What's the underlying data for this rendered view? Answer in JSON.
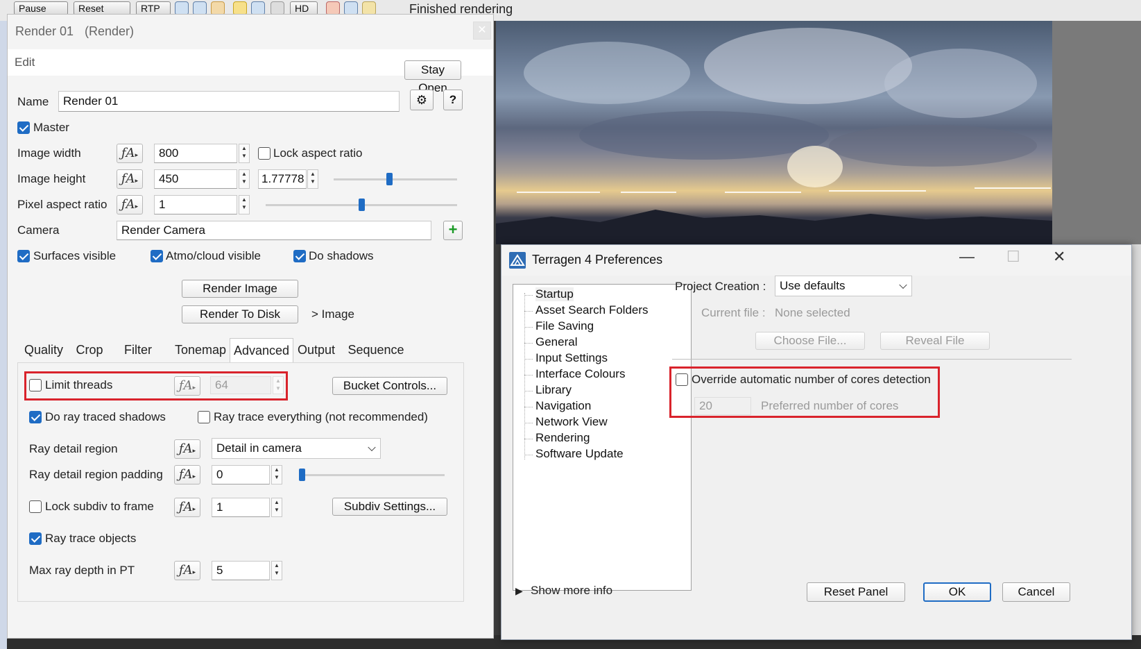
{
  "topbar": {
    "buttons": [
      "Pause",
      "Reset",
      "RTP",
      "HD"
    ],
    "status": "Finished rendering"
  },
  "render_panel": {
    "title": "Render 01",
    "subtitle": "(Render)",
    "menu": "Edit",
    "stay_open": "Stay Open",
    "name_label": "Name",
    "name_value": "Render 01",
    "help": "?",
    "master_label": "Master",
    "image_width_label": "Image width",
    "image_width_value": "800",
    "lock_aspect_label": "Lock aspect ratio",
    "image_height_label": "Image height",
    "image_height_value": "450",
    "aspect_value": "1.77778",
    "pixel_aspect_label": "Pixel aspect ratio",
    "pixel_aspect_value": "1",
    "camera_label": "Camera",
    "camera_value": "Render Camera",
    "surfaces_label": "Surfaces visible",
    "atmo_label": "Atmo/cloud visible",
    "shadows_label": "Do shadows",
    "render_image": "Render Image",
    "render_to_disk": "Render To Disk",
    "image_link": ">  Image",
    "tabs": [
      "Quality",
      "Crop",
      "Filter",
      "Tonemap",
      "Advanced",
      "Output",
      "Sequence"
    ],
    "active_tab": "Advanced",
    "limit_threads_label": "Limit threads",
    "limit_threads_value": "64",
    "bucket_controls": "Bucket Controls...",
    "ray_traced_shadows_label": "Do ray traced shadows",
    "ray_trace_everything_label": "Ray trace everything (not recommended)",
    "ray_detail_region_label": "Ray detail region",
    "ray_detail_region_value": "Detail in camera",
    "ray_detail_padding_label": "Ray detail region padding",
    "ray_detail_padding_value": "0",
    "lock_subdiv_label": "Lock subdiv to frame",
    "lock_subdiv_value": "1",
    "subdiv_settings": "Subdiv Settings...",
    "ray_trace_objects_label": "Ray trace objects",
    "max_ray_depth_label": "Max ray depth in PT",
    "max_ray_depth_value": "5",
    "checks": {
      "master": true,
      "lock_aspect": false,
      "surfaces": true,
      "atmo": true,
      "shadows": true,
      "limit_threads": false,
      "ray_traced_shadows": true,
      "ray_trace_everything": false,
      "lock_subdiv": false,
      "ray_trace_objects": true
    },
    "sliders": {
      "aspect_ratio_level": 0.45,
      "pixel_aspect_level": 0.5,
      "ray_padding_level": 0.0
    }
  },
  "prefs": {
    "title": "Terragen 4 Preferences",
    "tree": [
      "Startup",
      "Asset Search Folders",
      "File Saving",
      "General",
      "Input Settings",
      "Interface Colours",
      "Library",
      "Navigation",
      "Network View",
      "Rendering",
      "Software Update"
    ],
    "selected_tree_item": "Startup",
    "project_creation_label": "Project Creation :",
    "project_creation_value": "Use defaults",
    "current_file_label": "Current file :",
    "current_file_value": "None selected",
    "choose_file": "Choose File...",
    "reveal_file": "Reveal File",
    "override_cores_label": "Override automatic number of cores detection",
    "override_cores_checked": false,
    "cores_value": "20",
    "cores_label": "Preferred number of cores",
    "show_more_info": "Show more info",
    "reset_panel": "Reset Panel",
    "ok": "OK",
    "cancel": "Cancel"
  },
  "colors": {
    "accent": "#1f6cc4",
    "highlight_red": "#d9232c"
  }
}
